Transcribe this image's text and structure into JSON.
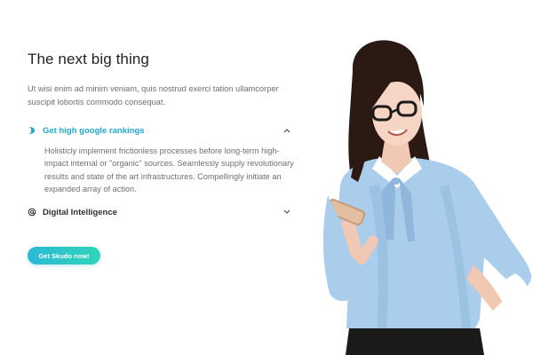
{
  "section": {
    "title": "The next big thing",
    "intro": "Ut wisi enim ad minim veniam, quis nostrud exerci tation ullamcorper suscipit lobortis commodo consequat."
  },
  "accordion": {
    "items": [
      {
        "label": "Get high google rankings",
        "icon": "leaf-icon",
        "expanded": true,
        "body": "Holisticly implement frictionless processes before long-term high-impact internal or \"organic\" sources. Seamlessly supply revolutionary results and state of the art infrastructures. Compellingly initiate an expanded array of action."
      },
      {
        "label": "Digital Intelligence",
        "icon": "at-icon",
        "expanded": false
      }
    ]
  },
  "cta": {
    "label": "Get Skudo now!"
  },
  "colors": {
    "accent": "#1eabd3",
    "button_start": "#2bb8d6",
    "button_end": "#2fd6b7",
    "text": "#1f1f1f",
    "muted": "#6f6f6f"
  },
  "hero_image": {
    "icon": "woman-with-phone-photo"
  }
}
